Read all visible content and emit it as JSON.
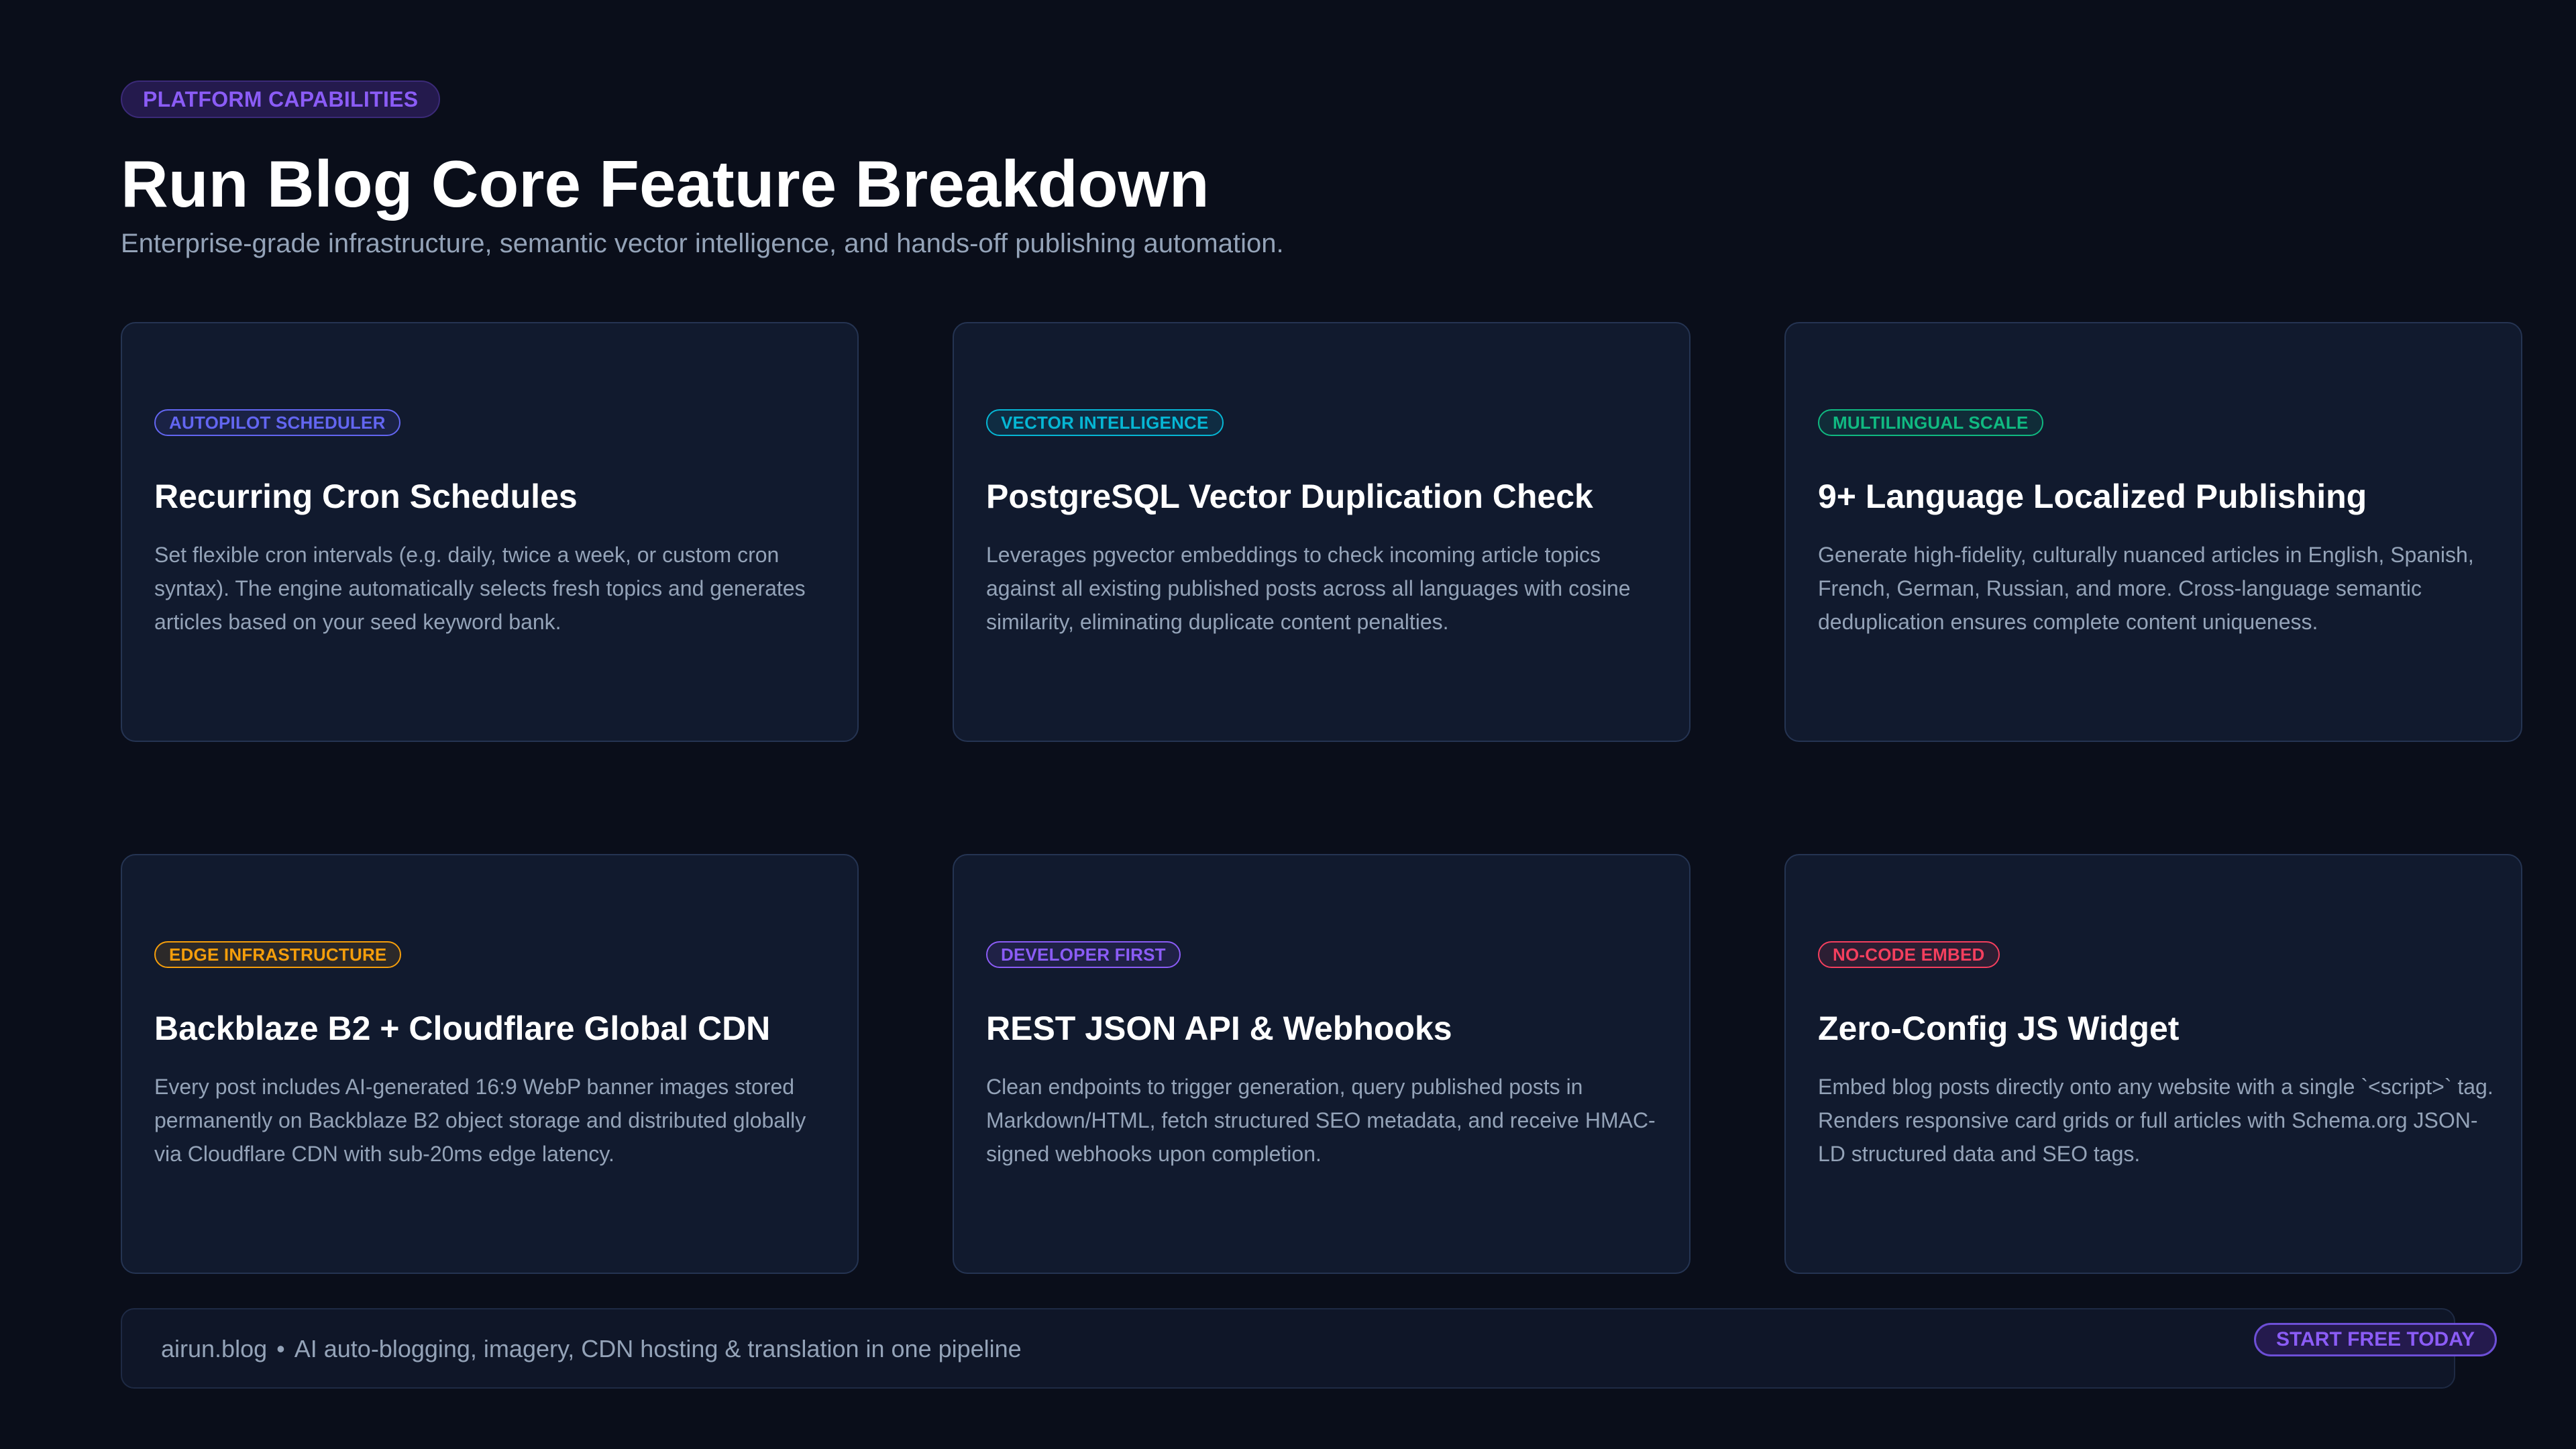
{
  "header": {
    "eyebrow": "PLATFORM CAPABILITIES",
    "title": "Run Blog Core Feature Breakdown",
    "subtitle": "Enterprise-grade infrastructure, semantic vector intelligence, and hands-off publishing automation."
  },
  "cards": [
    {
      "badge": "AUTOPILOT SCHEDULER",
      "badge_color": "#6366f1",
      "title": "Recurring Cron Schedules",
      "description": "Set flexible cron intervals (e.g. daily, twice a week, or custom cron syntax). The engine automatically selects fresh topics and generates articles based on your seed keyword bank."
    },
    {
      "badge": "VECTOR INTELLIGENCE",
      "badge_color": "#06b6d4",
      "title": "PostgreSQL Vector Duplication Check",
      "description": "Leverages pgvector embeddings to check incoming article topics against all existing published posts across all languages with cosine similarity, eliminating duplicate content penalties."
    },
    {
      "badge": "MULTILINGUAL SCALE",
      "badge_color": "#10b981",
      "title": "9+ Language Localized Publishing",
      "description": "Generate high-fidelity, culturally nuanced articles in English, Spanish, French, German, Russian, and more. Cross-language semantic deduplication ensures complete content uniqueness."
    },
    {
      "badge": "EDGE INFRASTRUCTURE",
      "badge_color": "#f59e0b",
      "title": "Backblaze B2 + Cloudflare Global CDN",
      "description": "Every post includes AI-generated 16:9 WebP banner images stored permanently on Backblaze B2 object storage and distributed globally via Cloudflare CDN with sub-20ms edge latency."
    },
    {
      "badge": "DEVELOPER FIRST",
      "badge_color": "#8b5cf6",
      "title": "REST JSON API & Webhooks",
      "description": "Clean endpoints to trigger generation, query published posts in Markdown/HTML, fetch structured SEO metadata, and receive HMAC-signed webhooks upon completion."
    },
    {
      "badge": "NO-CODE EMBED",
      "badge_color": "#f43f5e",
      "title": "Zero-Config JS Widget",
      "description": "Embed blog posts directly onto any website with a single `<script>` tag. Renders responsive card grids or full articles with Schema.org JSON-LD structured data and SEO tags."
    }
  ],
  "footer": {
    "site": "airun.blog",
    "separator": "•",
    "tagline": "AI auto-blogging, imagery, CDN hosting & translation in one pipeline",
    "cta_label": "START FREE TODAY"
  },
  "colors": {
    "background": "#0a0e1a",
    "card_background": "#111a2e",
    "accent": "#8b5cf6",
    "muted_text": "#94a3b8"
  }
}
